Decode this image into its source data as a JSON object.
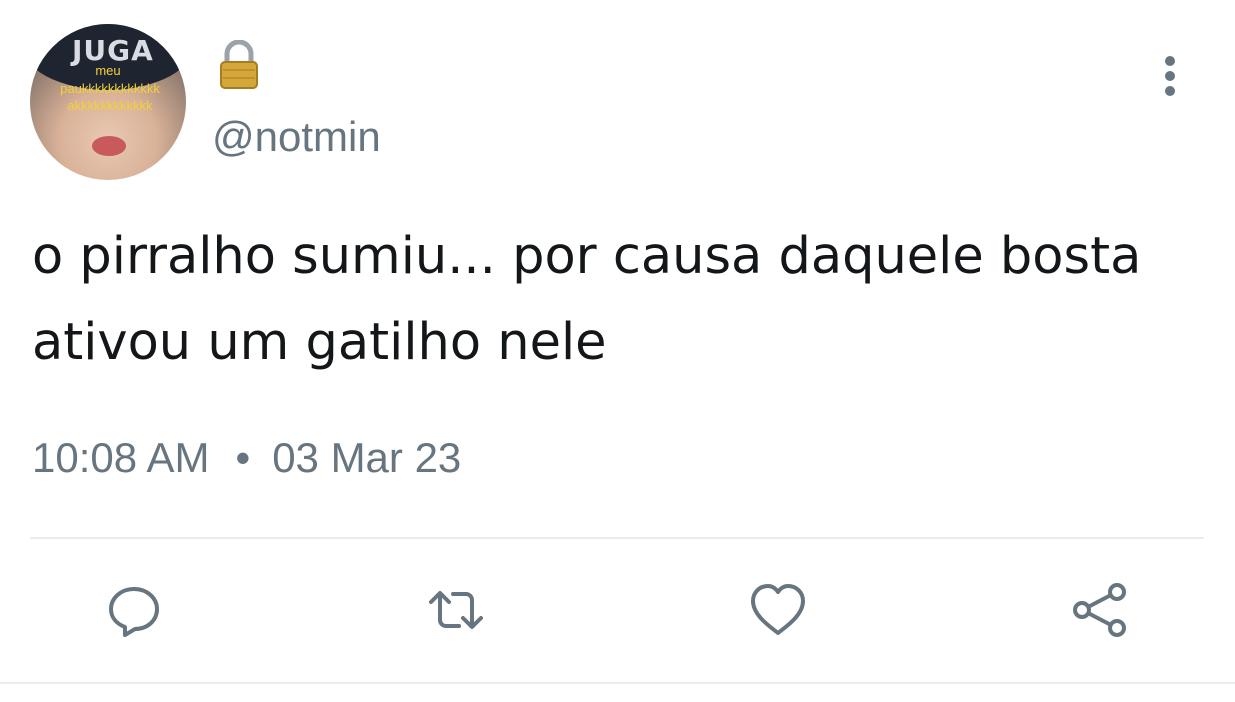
{
  "tweet": {
    "handle": "@notmin",
    "protected": true,
    "text": "o pirralho sumiu... por causa daquele bosta ativou um gatilho nele",
    "time": "10:08 AM",
    "separator": "•",
    "date": "03 Mar 23"
  },
  "avatar": {
    "cap_text": "JUGA",
    "meme_lines": [
      "meu",
      "paukkkkkkkkkkkk",
      "akkkkkkkkkkkk"
    ]
  },
  "icons": {
    "protected": "lock-icon",
    "menu": "more-vertical-icon",
    "reply": "reply-icon",
    "retweet": "retweet-icon",
    "like": "heart-icon",
    "share": "share-icon"
  },
  "colors": {
    "text": "#14171a",
    "secondary": "#66757f",
    "divider": "#e6ecf0",
    "lock_body": "#d4a73a"
  }
}
